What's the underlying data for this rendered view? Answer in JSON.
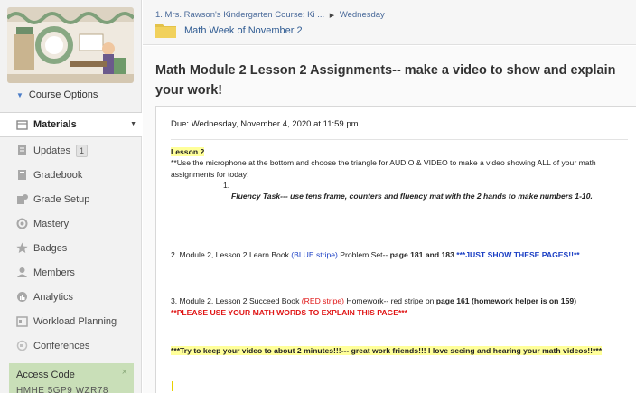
{
  "sidebar": {
    "course_options": "Course Options",
    "items": [
      {
        "label": "Materials",
        "icon": "materials-icon",
        "active": true
      },
      {
        "label": "Updates",
        "icon": "updates-icon",
        "badge": "1"
      },
      {
        "label": "Gradebook",
        "icon": "gradebook-icon"
      },
      {
        "label": "Grade Setup",
        "icon": "grade-setup-icon"
      },
      {
        "label": "Mastery",
        "icon": "mastery-icon"
      },
      {
        "label": "Badges",
        "icon": "badges-icon"
      },
      {
        "label": "Members",
        "icon": "members-icon"
      },
      {
        "label": "Analytics",
        "icon": "analytics-icon"
      },
      {
        "label": "Workload Planning",
        "icon": "workload-planning-icon"
      },
      {
        "label": "Conferences",
        "icon": "conferences-icon"
      }
    ],
    "access": {
      "label": "Access Code",
      "close": "×",
      "code": "HMHE 5GP9 WZR78"
    }
  },
  "header": {
    "breadcrumb_parent": "1. Mrs. Rawson's Kindergarten Course: Ki ...",
    "breadcrumb_sep": "▶",
    "breadcrumb_current": "Wednesday",
    "folder_title": "Math Week of November 2"
  },
  "main": {
    "title": "Math Module 2 Lesson 2 Assignments-- make a video to show and explain your work!",
    "due": "Due: Wednesday, November 4, 2020 at 11:59 pm",
    "lesson_heading": "Lesson 2",
    "intro": "**Use the microphone at the bottom and choose the triangle for AUDIO & VIDEO to make a video showing ALL of your math assignments for today!",
    "list_number": "1.",
    "fluency": "Fluency Task--- use tens frame, counters and fluency mat with the 2 hands to make numbers 1-10.",
    "item2": {
      "prefix": "2.  Module 2, Lesson 2 Learn Book ",
      "stripe": "(BLUE stripe)",
      "mid": " Problem Set-- ",
      "pages": "page 181 and 183",
      "note": " ***JUST SHOW THESE PAGES!!**"
    },
    "item3": {
      "prefix": "3. Module 2, Lesson 2 Succeed Book ",
      "stripe": "(RED stripe)",
      "mid": " Homework-- red stripe on ",
      "pages": "page 161 (homework helper is on 159)",
      "note": " **PLEASE USE YOUR MATH WORDS TO EXPLAIN THIS PAGE***"
    },
    "closing": "***Try to keep your video to about 2 minutes!!!--- great work friends!!!  I love seeing and hearing your math videos!!***"
  },
  "colors": {
    "highlight": "#ffff99",
    "blue_text": "#1b3fc4",
    "red_text": "#e01515",
    "access_box": "#c9dfb8",
    "link": "#2f5b92"
  }
}
